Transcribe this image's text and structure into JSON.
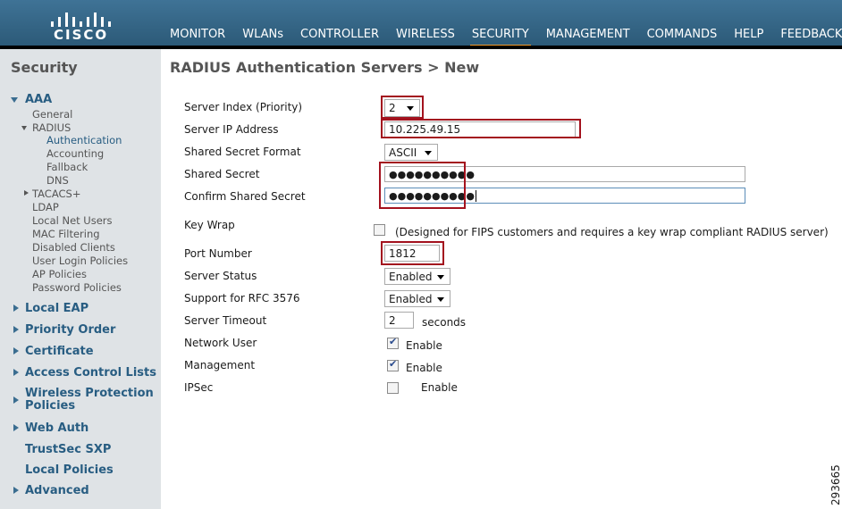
{
  "header": {
    "brand": "CISCO",
    "nav": [
      {
        "label": "MONITOR"
      },
      {
        "label": "WLANs"
      },
      {
        "label": "CONTROLLER"
      },
      {
        "label": "WIRELESS"
      },
      {
        "label": "SECURITY",
        "active": true
      },
      {
        "label": "MANAGEMENT"
      },
      {
        "label": "COMMANDS"
      },
      {
        "label": "HELP"
      },
      {
        "label": "FEEDBACK"
      }
    ]
  },
  "sidebar": {
    "title": "Security",
    "aaa": "AAA",
    "general": "General",
    "radius": "RADIUS",
    "radius_children": [
      "Authentication",
      "Accounting",
      "Fallback",
      "DNS"
    ],
    "tacacs": "TACACS+",
    "aaa_children": [
      "LDAP",
      "Local Net Users",
      "MAC Filtering",
      "Disabled Clients",
      "User Login Policies",
      "AP Policies",
      "Password Policies"
    ],
    "sections": [
      "Local EAP",
      "Priority Order",
      "Certificate",
      "Access Control Lists",
      "Wireless Protection Policies",
      "Web Auth",
      "TrustSec SXP",
      "Local Policies",
      "Advanced"
    ]
  },
  "page": {
    "title": "RADIUS Authentication Servers > New"
  },
  "form": {
    "server_index_label": "Server Index (Priority)",
    "server_index_value": "2",
    "server_ip_label": "Server IP Address",
    "server_ip_value": "10.225.49.15",
    "secret_format_label": "Shared Secret Format",
    "secret_format_value": "ASCII",
    "secret_label": "Shared Secret",
    "secret_value": "●●●●●●●●●●",
    "confirm_secret_label": "Confirm Shared Secret",
    "confirm_secret_value": "●●●●●●●●●●",
    "key_wrap_label": "Key Wrap",
    "key_wrap_note": "(Designed for FIPS customers and requires a key wrap compliant RADIUS server)",
    "port_label": "Port Number",
    "port_value": "1812",
    "status_label": "Server Status",
    "status_value": "Enabled",
    "rfc_label": "Support for RFC 3576",
    "rfc_value": "Enabled",
    "timeout_label": "Server Timeout",
    "timeout_value": "2",
    "timeout_unit": "seconds",
    "network_user_label": "Network User",
    "network_user_enable": "Enable",
    "management_label": "Management",
    "management_enable": "Enable",
    "ipsec_label": "IPSec",
    "ipsec_enable": "Enable"
  },
  "figure_number": "293665"
}
